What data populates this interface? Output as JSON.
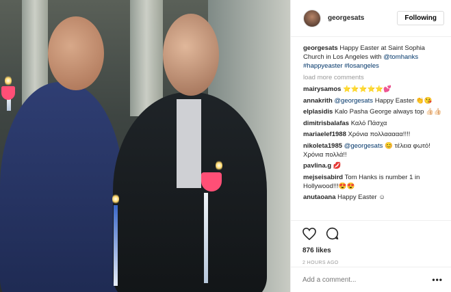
{
  "header": {
    "username": "georgesats",
    "follow_label": "Following"
  },
  "caption": {
    "user": "georgesats",
    "text_before": "Happy Easter at Saint Sophia Church in Los Angeles with ",
    "mention": "@tomhanks",
    "hashtags": "#happyeaster #losangeles"
  },
  "load_more": "load more comments",
  "comments": [
    {
      "user": "mairysamos",
      "text": "⭐⭐⭐⭐⭐💕"
    },
    {
      "user": "annakrith",
      "mention": "@georgesats",
      "text": "Happy Easter 👏😘"
    },
    {
      "user": "elplasidis",
      "text": "Kalo Pasha George always top 👍🏻👍🏻"
    },
    {
      "user": "dimitrisbalafas",
      "text": "Καλό Πάσχα"
    },
    {
      "user": "mariaelef1988",
      "text": "Χρόνια πολλααααα!!!!"
    },
    {
      "user": "nikoleta1985",
      "mention": "@georgesats",
      "text": "😊 τέλεια φωτό! Χρόνια πολλά!!"
    },
    {
      "user": "pavlina.g",
      "text": "💋"
    },
    {
      "user": "mejseisabird",
      "text": "Tom Hanks is number 1 in Hollywood!!!😍😍"
    },
    {
      "user": "anutaoana",
      "text": "Happy Easter ☺"
    }
  ],
  "likes": "876 likes",
  "time": "2 HOURS AGO",
  "add_comment_placeholder": "Add a comment...",
  "more_options": "•••",
  "icons": [
    "heart-icon",
    "comment-icon",
    "more-options-icon"
  ],
  "colors": {
    "link": "#003569",
    "muted": "#999999",
    "border": "#dbdbdb"
  }
}
